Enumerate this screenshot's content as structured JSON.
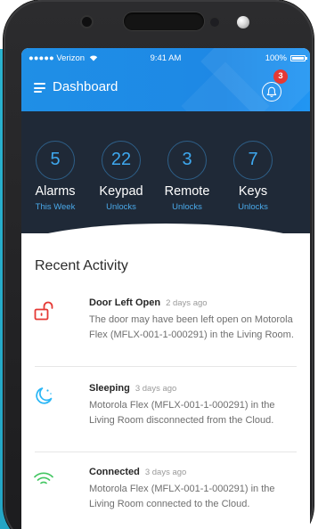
{
  "status_bar": {
    "carrier": "●●●●● Verizon",
    "time": "9:41 AM",
    "battery": "100%"
  },
  "header": {
    "menu_icon": "hamburger-menu-icon",
    "title": "Dashboard",
    "notification_icon": "bell-icon",
    "notification_count": "3"
  },
  "stats": [
    {
      "value": "5",
      "label": "Alarms",
      "sublabel": "This Week"
    },
    {
      "value": "22",
      "label": "Keypad",
      "sublabel": "Unlocks"
    },
    {
      "value": "3",
      "label": "Remote",
      "sublabel": "Unlocks"
    },
    {
      "value": "7",
      "label": "Keys",
      "sublabel": "Unlocks"
    }
  ],
  "recent_activity": {
    "title": "Recent Activity",
    "items": [
      {
        "icon": "unlocked-padlock-icon",
        "title": "Door Left Open",
        "time": "2 days ago",
        "description": "The door may have been left open on Motorola Flex (MFLX-001-1-000291) in the Living Room."
      },
      {
        "icon": "moon-sleep-icon",
        "title": "Sleeping",
        "time": "3 days ago",
        "description": "Motorola Flex (MFLX-001-1-000291) in the Living Room disconnected from the Cloud."
      },
      {
        "icon": "wifi-signal-icon",
        "title": "Connected",
        "time": "3 days ago",
        "description": "Motorola Flex (MFLX-001-1-000291) in the Living Room connected to the Cloud."
      }
    ]
  },
  "colors": {
    "appbar": "#1e88e5",
    "stats_background": "#1f2937",
    "accent": "#3ea8ef",
    "alert_red": "#e53935",
    "sleep_blue": "#29b6f6",
    "connected_green": "#43c662"
  }
}
